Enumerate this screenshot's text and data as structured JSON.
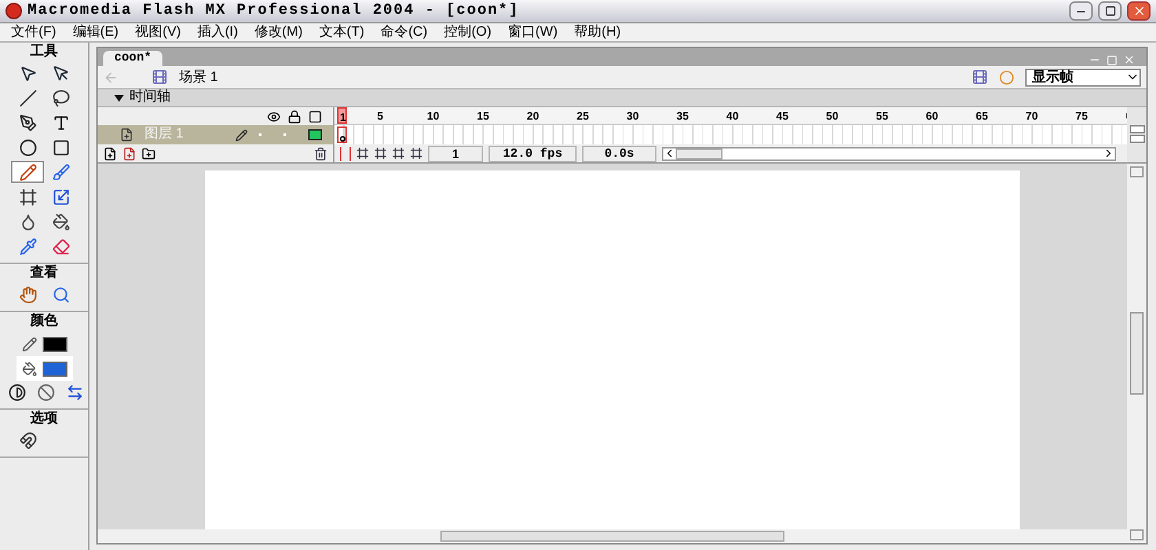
{
  "window": {
    "title": "Macromedia Flash MX Professional 2004 - [coon*]"
  },
  "menu": [
    "文件(F)",
    "编辑(E)",
    "视图(V)",
    "插入(I)",
    "修改(M)",
    "文本(T)",
    "命令(C)",
    "控制(O)",
    "窗口(W)",
    "帮助(H)"
  ],
  "tools_panel": [
    {
      "title": "工具",
      "tools": [
        {
          "kind": "arrow",
          "selected": false
        },
        {
          "kind": "subselect",
          "selected": false
        },
        {
          "kind": "line",
          "selected": false
        },
        {
          "kind": "lasso",
          "selected": false
        },
        {
          "kind": "pen",
          "selected": false
        },
        {
          "kind": "text",
          "selected": false
        },
        {
          "kind": "oval",
          "selected": false
        },
        {
          "kind": "rectangle",
          "selected": false
        },
        {
          "kind": "pencil",
          "selected": true
        },
        {
          "kind": "brush",
          "selected": false
        },
        {
          "kind": "transform",
          "selected": false
        },
        {
          "kind": "gradient",
          "selected": false
        },
        {
          "kind": "ink",
          "selected": false
        },
        {
          "kind": "bucket",
          "selected": false
        },
        {
          "kind": "eyedropper",
          "selected": false
        },
        {
          "kind": "eraser",
          "selected": false
        }
      ]
    },
    {
      "title": "查看",
      "tools": [
        {
          "kind": "hand",
          "selected": false
        },
        {
          "kind": "zoom",
          "selected": false
        }
      ]
    },
    {
      "title": "颜色",
      "swatches": [
        {
          "kind": "stroke",
          "color": "#000000",
          "selected": false
        },
        {
          "kind": "fill",
          "color": "#1f64d6",
          "selected": true
        }
      ],
      "tools": [
        {
          "kind": "default-colors",
          "selected": false
        },
        {
          "kind": "no-color",
          "selected": false
        },
        {
          "kind": "swap",
          "selected": false
        }
      ]
    },
    {
      "title": "选项",
      "tools": [
        {
          "kind": "snap",
          "selected": false
        }
      ]
    }
  ],
  "document": {
    "tab": "coon*",
    "scene": "场景 1",
    "view_select": "显示帧",
    "timeline": {
      "title": "时间轴",
      "frame_numbers": [
        "1",
        "5",
        "10",
        "15",
        "20",
        "25",
        "30",
        "35",
        "40",
        "45",
        "50",
        "55",
        "60",
        "65",
        "70",
        "75"
      ],
      "layers": [
        {
          "name": "图层 1",
          "selected": true
        }
      ],
      "current_frame": "1",
      "frame_rate": "12.0 fps",
      "elapsed_time": "0.0s"
    }
  }
}
